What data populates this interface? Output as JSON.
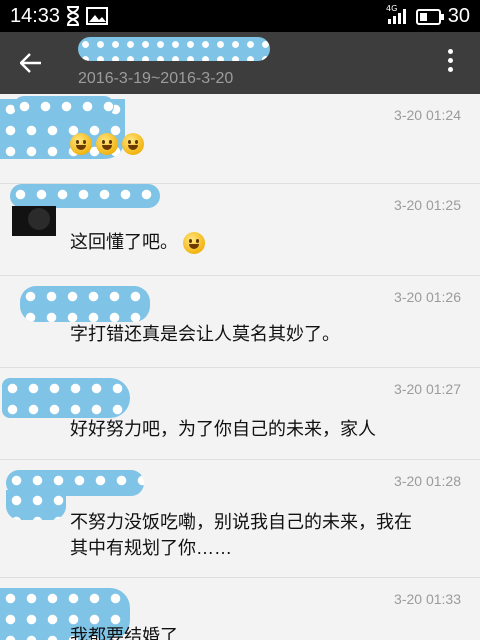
{
  "status_bar": {
    "time": "14:33",
    "icons": [
      "hourglass-icon",
      "image-icon"
    ],
    "network_label": "4G",
    "battery_level_text": "30"
  },
  "app_bar": {
    "back_icon": "back-arrow-icon",
    "date_range": "2016-3-19~2016-3-20",
    "more_icon": "more-vertical-icon"
  },
  "messages": [
    {
      "timestamp": "3-20 01:24",
      "text": "",
      "emoji_count": 3
    },
    {
      "timestamp": "3-20 01:25",
      "text": "这回懂了吧。",
      "emoji_count": 1
    },
    {
      "timestamp": "3-20 01:26",
      "text": "字打错还真是会让人莫名其妙了。"
    },
    {
      "timestamp": "3-20 01:27",
      "text": "好好努力吧，为了你自己的未来，家人"
    },
    {
      "timestamp": "3-20 01:28",
      "text": "不努力没饭吃嘞，别说我自己的未来，我在",
      "text2": "其中有规划了你……"
    },
    {
      "timestamp": "3-20 01:33",
      "text": "我都要结婚了"
    }
  ],
  "colors": {
    "status_bar": "#000000",
    "app_bar": "#3d3d3d",
    "background": "#f3f3f3",
    "blur_blue": "#7fc3e6"
  }
}
